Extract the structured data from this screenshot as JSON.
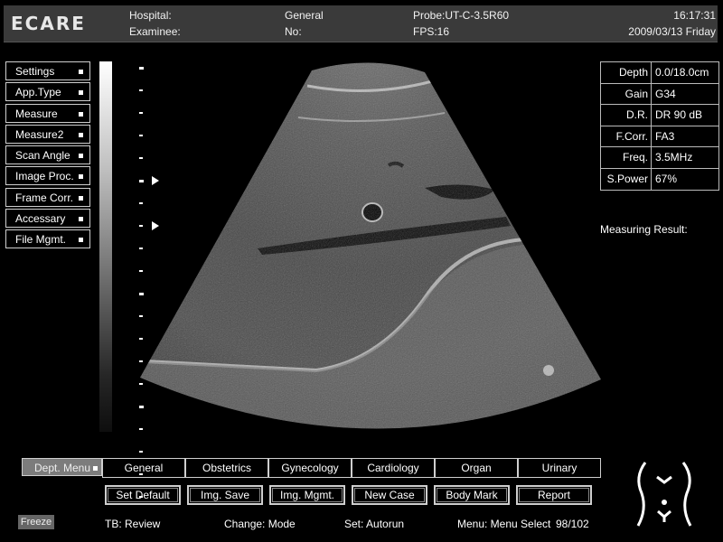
{
  "header": {
    "logo": "ECARE",
    "hospital_label": "Hospital:",
    "examinee_label": "Examinee:",
    "dept": "General",
    "no_label": "No:",
    "probe": "Probe:UT-C-3.5R60",
    "fps": "FPS:16",
    "time": "16:17:31",
    "date": "2009/03/13 Friday"
  },
  "left_menu": [
    {
      "label": "Settings"
    },
    {
      "label": "App.Type"
    },
    {
      "label": "Measure"
    },
    {
      "label": "Measure2"
    },
    {
      "label": "Scan Angle"
    },
    {
      "label": "Image Proc."
    },
    {
      "label": "Frame Corr."
    },
    {
      "label": "Accessary"
    },
    {
      "label": "File Mgmt."
    }
  ],
  "params": [
    {
      "label": "Depth",
      "value": "0.0/18.0cm"
    },
    {
      "label": "Gain",
      "value": "G34"
    },
    {
      "label": "D.R.",
      "value": "DR 90 dB"
    },
    {
      "label": "F.Corr.",
      "value": "FA3"
    },
    {
      "label": "Freq.",
      "value": "3.5MHz"
    },
    {
      "label": "S.Power",
      "value": "67%"
    }
  ],
  "measuring_result": "Measuring Result:",
  "dept_menu": "Dept. Menu",
  "dept_tabs": [
    "General",
    "Obstetrics",
    "Gynecology",
    "Cardiology",
    "Organ",
    "Urinary"
  ],
  "actions": [
    "Set Default",
    "Img. Save",
    "Img. Mgmt.",
    "New Case",
    "Body Mark",
    "Report"
  ],
  "footer": {
    "freeze": "Freeze",
    "tb": "TB: Review",
    "change": "Change: Mode",
    "set": "Set: Autorun",
    "menu": "Menu: Menu Select",
    "counter": "98/102"
  },
  "icons": {
    "body_mark": "abdomen-bodymark-icon",
    "menu_indicator": "square-bullet-icon",
    "focus_marker": "triangle-right-icon"
  },
  "colors": {
    "background": "#000000",
    "header_bg": "#3a3a3a",
    "dept_menu_bg": "#7c7c7c",
    "border": "#cfcfcf"
  }
}
